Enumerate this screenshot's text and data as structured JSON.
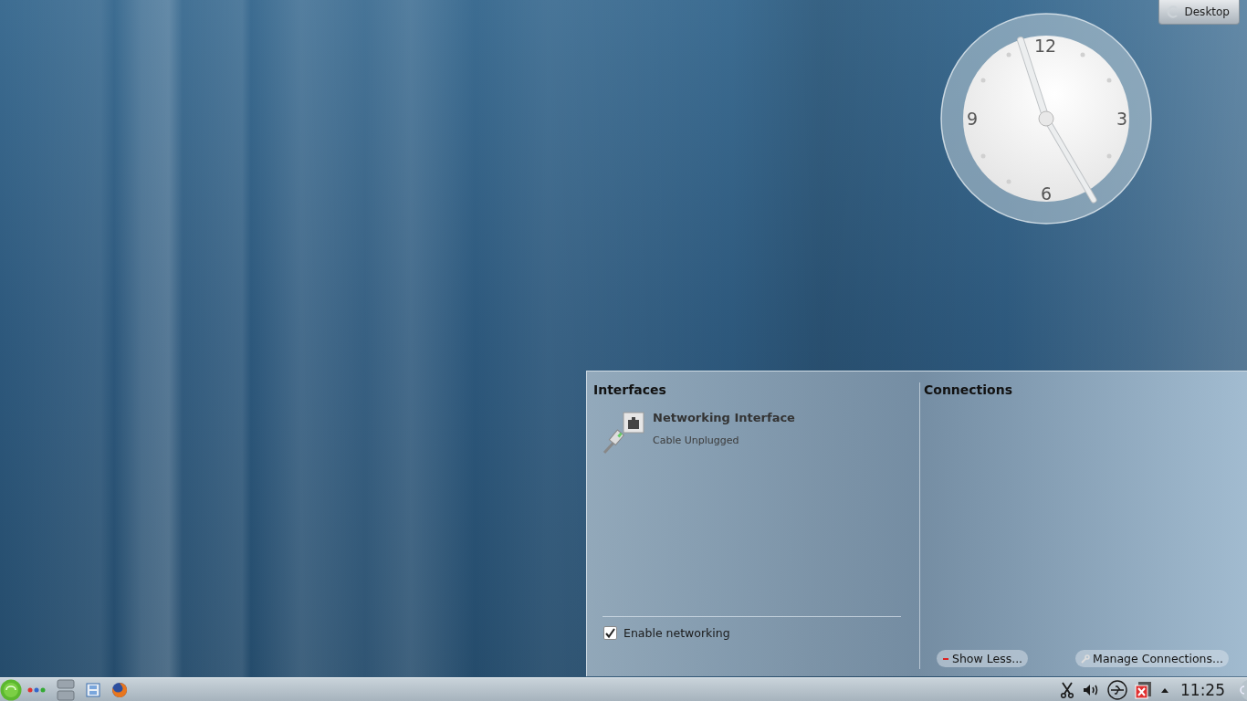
{
  "desktop_button": {
    "label": "Desktop"
  },
  "clock_widget": {
    "numerals": [
      "12",
      "3",
      "6",
      "9"
    ]
  },
  "network_popup": {
    "interfaces": {
      "title": "Interfaces",
      "items": [
        {
          "name": "Networking Interface",
          "status": "Cable Unplugged"
        }
      ]
    },
    "enable_networking": {
      "label": "Enable networking",
      "checked": true
    },
    "connections": {
      "title": "Connections"
    },
    "buttons": [
      {
        "kind": "show-less",
        "label": "Show Less..."
      },
      {
        "kind": "manage",
        "label": "Manage Connections..."
      }
    ]
  },
  "taskbar": {
    "time": "11:25"
  }
}
